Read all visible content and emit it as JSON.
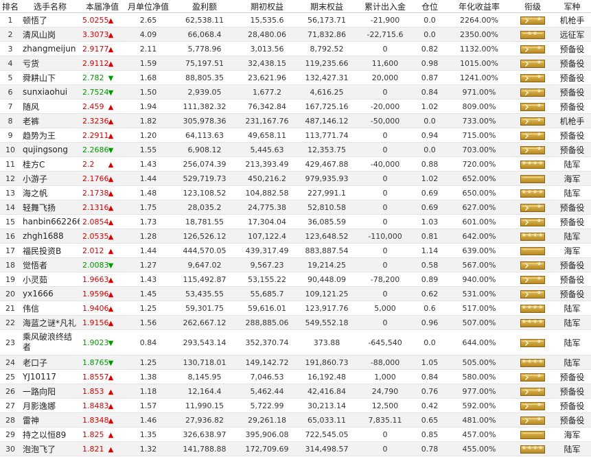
{
  "headers": [
    "排名",
    "选手名称",
    "本届净值",
    "月单位净值",
    "盈利额",
    "期初权益",
    "期末权益",
    "累计出入金",
    "仓位",
    "年化收益率",
    "衔级",
    "军种"
  ],
  "icons": {
    "up": "up-arrow-icon",
    "down": "down-arrow-icon",
    "rank": "rank-insignia-icon"
  },
  "colors": {
    "up": "#d80000",
    "down": "#009a00",
    "badge": "#c9a23c"
  },
  "rows": [
    {
      "rank": "1",
      "name": "顿悟了",
      "nav": "5.0255",
      "dir": "up",
      "month": "2.65",
      "profit": "62,538.11",
      "start": "15,535.6",
      "end": "56,173.71",
      "flow": "-21,900",
      "pos": "0.0",
      "annual": "2264.00%",
      "badge": "chev",
      "army": "机枪手"
    },
    {
      "rank": "2",
      "name": "清风山岗",
      "nav": "3.3073",
      "dir": "up",
      "month": "4.09",
      "profit": "66,068.4",
      "start": "28,480.06",
      "end": "71,832.86",
      "flow": "-22,715.6",
      "pos": "0.0",
      "annual": "2350.00%",
      "badge": "stars2",
      "army": "远征军"
    },
    {
      "rank": "3",
      "name": "zhangmeijun",
      "nav": "2.9177",
      "dir": "up",
      "month": "2.11",
      "profit": "5,778.96",
      "start": "3,013.56",
      "end": "8,792.52",
      "flow": "0",
      "pos": "0.82",
      "annual": "1132.00%",
      "badge": "chev",
      "army": "预备役"
    },
    {
      "rank": "4",
      "name": "亏货",
      "nav": "2.9112",
      "dir": "up",
      "month": "1.59",
      "profit": "75,197.51",
      "start": "32,438.15",
      "end": "119,235.66",
      "flow": "11,600",
      "pos": "0.98",
      "annual": "1015.00%",
      "badge": "chev",
      "army": "预备役"
    },
    {
      "rank": "5",
      "name": "舜耕山下",
      "nav": "2.782",
      "dir": "down",
      "month": "1.68",
      "profit": "88,805.35",
      "start": "23,621.96",
      "end": "132,427.31",
      "flow": "20,000",
      "pos": "0.87",
      "annual": "1241.00%",
      "badge": "chev",
      "army": "预备役"
    },
    {
      "rank": "6",
      "name": "sunxiaohui",
      "nav": "2.7524",
      "dir": "down",
      "month": "1.50",
      "profit": "2,939.05",
      "start": "1,677.2",
      "end": "4,616.25",
      "flow": "0",
      "pos": "0.84",
      "annual": "971.00%",
      "badge": "chev",
      "army": "预备役"
    },
    {
      "rank": "7",
      "name": "随风",
      "nav": "2.459",
      "dir": "up",
      "month": "1.94",
      "profit": "111,382.32",
      "start": "76,342.84",
      "end": "167,725.16",
      "flow": "-20,000",
      "pos": "1.02",
      "annual": "809.00%",
      "badge": "chev",
      "army": "预备役"
    },
    {
      "rank": "8",
      "name": "老裤",
      "nav": "2.3236",
      "dir": "up",
      "month": "1.82",
      "profit": "305,978.36",
      "start": "231,167.76",
      "end": "487,146.12",
      "flow": "-50,000",
      "pos": "0.0",
      "annual": "733.00%",
      "badge": "chev",
      "army": "机枪手"
    },
    {
      "rank": "9",
      "name": "趋势为王",
      "nav": "2.2911",
      "dir": "up",
      "month": "1.20",
      "profit": "64,113.63",
      "start": "49,658.11",
      "end": "113,771.74",
      "flow": "0",
      "pos": "0.94",
      "annual": "715.00%",
      "badge": "chev",
      "army": "预备役"
    },
    {
      "rank": "10",
      "name": "qujingsong",
      "nav": "2.2686",
      "dir": "down",
      "month": "1.55",
      "profit": "6,908.12",
      "start": "5,445.63",
      "end": "12,353.75",
      "flow": "0",
      "pos": "0.0",
      "annual": "703.00%",
      "badge": "chev",
      "army": "预备役"
    },
    {
      "rank": "11",
      "name": "桂方C",
      "nav": "2.2",
      "dir": "up",
      "month": "1.43",
      "profit": "256,074.39",
      "start": "213,393.49",
      "end": "429,467.88",
      "flow": "-40,000",
      "pos": "0.88",
      "annual": "720.00%",
      "badge": "stars4",
      "army": "陆军"
    },
    {
      "rank": "12",
      "name": "小游子",
      "nav": "2.1766",
      "dir": "up",
      "month": "1.44",
      "profit": "529,719.73",
      "start": "450,216.2",
      "end": "979,935.93",
      "flow": "0",
      "pos": "1.02",
      "annual": "652.00%",
      "badge": "plain",
      "army": "海军"
    },
    {
      "rank": "13",
      "name": "海之帆",
      "nav": "2.1738",
      "dir": "up",
      "month": "1.48",
      "profit": "123,108.52",
      "start": "104,882.58",
      "end": "227,991.1",
      "flow": "0",
      "pos": "0.69",
      "annual": "650.00%",
      "badge": "stars4",
      "army": "陆军"
    },
    {
      "rank": "14",
      "name": "轻舞飞扬",
      "nav": "2.1316",
      "dir": "up",
      "month": "1.75",
      "profit": "28,035.2",
      "start": "24,775.38",
      "end": "52,810.58",
      "flow": "0",
      "pos": "0.69",
      "annual": "627.00%",
      "badge": "chev",
      "army": "预备役"
    },
    {
      "rank": "15",
      "name": "hanbin662266",
      "nav": "2.0854",
      "dir": "up",
      "month": "1.73",
      "profit": "18,781.55",
      "start": "17,304.04",
      "end": "36,085.59",
      "flow": "0",
      "pos": "1.03",
      "annual": "601.00%",
      "badge": "chev",
      "army": "预备役"
    },
    {
      "rank": "16",
      "name": "zhgh1688",
      "nav": "2.0535",
      "dir": "up",
      "month": "1.28",
      "profit": "126,526.12",
      "start": "107,122.4",
      "end": "123,648.52",
      "flow": "-110,000",
      "pos": "0.81",
      "annual": "642.00%",
      "badge": "stars4",
      "army": "陆军"
    },
    {
      "rank": "17",
      "name": "福民投资B",
      "nav": "2.012",
      "dir": "up",
      "month": "1.44",
      "profit": "444,570.05",
      "start": "439,317.49",
      "end": "883,887.54",
      "flow": "0",
      "pos": "1.14",
      "annual": "639.00%",
      "badge": "plain",
      "army": "海军"
    },
    {
      "rank": "18",
      "name": "觉悟者",
      "nav": "2.0083",
      "dir": "down",
      "month": "1.27",
      "profit": "9,647.02",
      "start": "9,567.23",
      "end": "19,214.25",
      "flow": "0",
      "pos": "0.58",
      "annual": "567.00%",
      "badge": "chev",
      "army": "预备役"
    },
    {
      "rank": "19",
      "name": "小灵茹",
      "nav": "1.9663",
      "dir": "up",
      "month": "1.43",
      "profit": "115,492.87",
      "start": "53,155.22",
      "end": "90,448.09",
      "flow": "-78,200",
      "pos": "0.89",
      "annual": "940.00%",
      "badge": "chev",
      "army": "预备役"
    },
    {
      "rank": "20",
      "name": "yx1666",
      "nav": "1.9596",
      "dir": "up",
      "month": "1.45",
      "profit": "53,435.55",
      "start": "55,685.7",
      "end": "109,121.25",
      "flow": "0",
      "pos": "0.62",
      "annual": "531.00%",
      "badge": "chev",
      "army": "预备役"
    },
    {
      "rank": "21",
      "name": "伟信",
      "nav": "1.9406",
      "dir": "up",
      "month": "1.25",
      "profit": "59,301.75",
      "start": "59,616.01",
      "end": "123,917.76",
      "flow": "5,000",
      "pos": "0.6",
      "annual": "517.00%",
      "badge": "stars4",
      "army": "陆军"
    },
    {
      "rank": "22",
      "name": "海蓝之谜*凡礼",
      "nav": "1.9156",
      "dir": "up",
      "month": "1.56",
      "profit": "262,667.12",
      "start": "288,885.06",
      "end": "549,552.18",
      "flow": "0",
      "pos": "0.96",
      "annual": "507.00%",
      "badge": "stars4",
      "army": "陆军"
    },
    {
      "rank": "23",
      "name": "乘风破浪终结者",
      "nav": "1.9023",
      "dir": "down",
      "month": "0.84",
      "profit": "293,543.14",
      "start": "352,370.74",
      "end": "373.88",
      "flow": "-645,540",
      "pos": "0.0",
      "annual": "644.00%",
      "badge": "chev",
      "army": "陆军"
    },
    {
      "rank": "24",
      "name": "老口子",
      "nav": "1.8765",
      "dir": "down",
      "month": "1.25",
      "profit": "130,718.01",
      "start": "149,142.72",
      "end": "191,860.73",
      "flow": "-88,000",
      "pos": "1.05",
      "annual": "505.00%",
      "badge": "stars4",
      "army": "陆军"
    },
    {
      "rank": "25",
      "name": "YJ10117",
      "nav": "1.8557",
      "dir": "up",
      "month": "1.38",
      "profit": "8,145.95",
      "start": "7,046.53",
      "end": "16,192.48",
      "flow": "1,000",
      "pos": "0.84",
      "annual": "580.00%",
      "badge": "chev",
      "army": "预备役"
    },
    {
      "rank": "26",
      "name": "一路向阳",
      "nav": "1.853",
      "dir": "up",
      "month": "1.18",
      "profit": "12,164.4",
      "start": "5,462.44",
      "end": "42,416.84",
      "flow": "24,790",
      "pos": "0.76",
      "annual": "977.00%",
      "badge": "chev",
      "army": "预备役"
    },
    {
      "rank": "27",
      "name": "月影逸娜",
      "nav": "1.8483",
      "dir": "up",
      "month": "1.57",
      "profit": "11,990.15",
      "start": "5,722.99",
      "end": "30,213.14",
      "flow": "12,500",
      "pos": "0.42",
      "annual": "592.00%",
      "badge": "chev",
      "army": "预备役"
    },
    {
      "rank": "28",
      "name": "雷神",
      "nav": "1.8348",
      "dir": "up",
      "month": "1.46",
      "profit": "27,936.82",
      "start": "29,261.18",
      "end": "65,033.11",
      "flow": "7,835.11",
      "pos": "0.65",
      "annual": "481.00%",
      "badge": "chev",
      "army": "预备役"
    },
    {
      "rank": "29",
      "name": "持之以恒89",
      "nav": "1.825",
      "dir": "up",
      "month": "1.35",
      "profit": "326,638.97",
      "start": "395,906.08",
      "end": "722,545.05",
      "flow": "0",
      "pos": "0.85",
      "annual": "457.00%",
      "badge": "plain",
      "army": "海军"
    },
    {
      "rank": "30",
      "name": "泡泡飞了",
      "nav": "1.821",
      "dir": "up",
      "month": "1.32",
      "profit": "141,788.88",
      "start": "172,709.69",
      "end": "314,498.57",
      "flow": "0",
      "pos": "0.78",
      "annual": "455.00%",
      "badge": "stars4",
      "army": "陆军"
    }
  ]
}
